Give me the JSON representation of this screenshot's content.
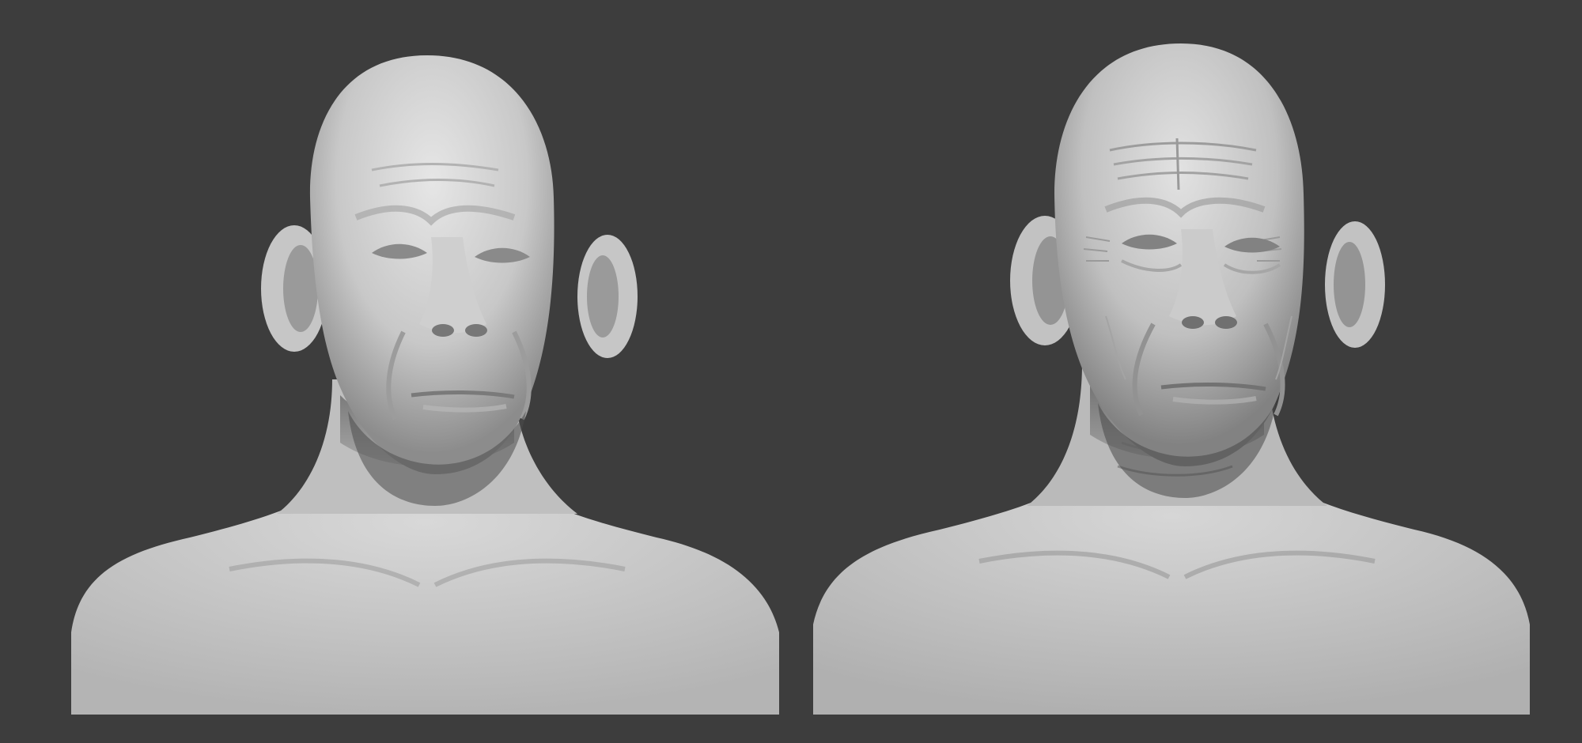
{
  "scene": {
    "background_color": "#3d3d3d",
    "renders": [
      {
        "id": "sculpt-smooth",
        "style": "smooth base sculpt",
        "detail": "low"
      },
      {
        "id": "sculpt-detailed",
        "style": "detailed skin sculpt",
        "detail": "high"
      }
    ],
    "colors": {
      "clay_highlight": "#e6e6e6",
      "clay_mid": "#bdbdbd",
      "clay_shadow": "#5a5a5a"
    }
  }
}
